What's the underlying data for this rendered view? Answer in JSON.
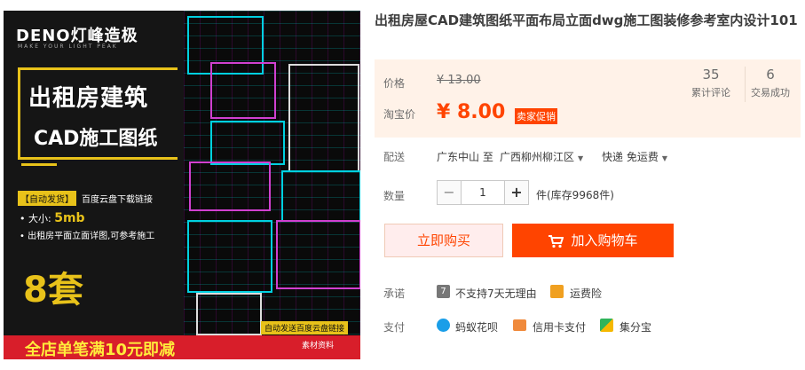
{
  "product_image": {
    "logo": "DENO灯峰造极",
    "logo_sub": "MAKE YOUR LIGHT PEAK",
    "headline_1": "出租房建筑",
    "headline_2": "CAD施工图纸",
    "auto_badge": "【自动发货】",
    "auto_badge_rest": "百度云盘下载链接",
    "size_label": "大小:",
    "size_value": "5mb",
    "desc": "出租房平面立面详图,可参考施工",
    "sets": "8套",
    "auto_send": "自动发送百度云盘链接",
    "promo": "全店单笔满10元即减",
    "promo_right": "素材资料"
  },
  "title": "出租房屋CAD建筑图纸平面布局立面dwg施工图装修参考室内设计101",
  "price": {
    "label": "价格",
    "old": "¥ 13.00",
    "taobao_label": "淘宝价",
    "current": "¥ 8.00",
    "badge": "卖家促销"
  },
  "stats": [
    {
      "value": "35",
      "label": "累计评论"
    },
    {
      "value": "6",
      "label": "交易成功"
    }
  ],
  "shipping": {
    "label": "配送",
    "from_to": "广东中山 至",
    "destination": "广西柳州柳江区",
    "method": "快递 免运费"
  },
  "quantity": {
    "label": "数量",
    "minus": "−",
    "value": "1",
    "plus": "+",
    "stock": "件(库存9968件)"
  },
  "actions": {
    "buy_now": "立即购买",
    "add_cart": "加入购物车"
  },
  "promise": {
    "label": "承诺",
    "items": [
      "不支持7天无理由",
      "运费险"
    ]
  },
  "payment": {
    "label": "支付",
    "items": [
      "蚂蚁花呗",
      "信用卡支付",
      "集分宝"
    ]
  },
  "colors": {
    "accent": "#ff4400",
    "price_bg": "#fff2e8",
    "gold": "#e8c21a"
  }
}
